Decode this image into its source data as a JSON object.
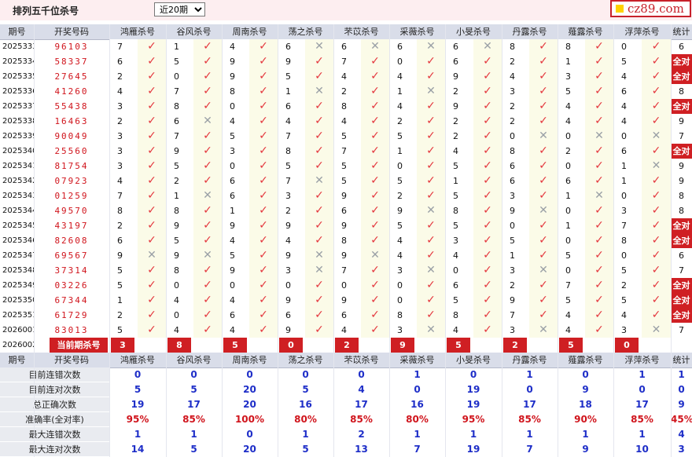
{
  "header": {
    "title": "排列五千位杀号",
    "range_selected": "近20期",
    "logo_text": "cz89.com"
  },
  "columns": [
    "期号",
    "开奖号码",
    "鸿雁杀号",
    "谷风杀号",
    "周南杀号",
    "荡之杀号",
    "芣苡杀号",
    "采薇杀号",
    "小旻杀号",
    "丹露杀号",
    "薤露杀号",
    "浮萍杀号",
    "统计"
  ],
  "rows": [
    {
      "period": "2025333",
      "draw": "96103",
      "kills": [
        7,
        1,
        4,
        6,
        6,
        6,
        6,
        8,
        8,
        0
      ],
      "marks": [
        1,
        1,
        1,
        0,
        0,
        0,
        0,
        1,
        1,
        1
      ],
      "stat": "6"
    },
    {
      "period": "2025334",
      "draw": "58337",
      "kills": [
        6,
        5,
        9,
        9,
        7,
        0,
        6,
        2,
        1,
        5
      ],
      "marks": [
        1,
        1,
        1,
        1,
        1,
        1,
        1,
        1,
        1,
        1
      ],
      "stat": "全对"
    },
    {
      "period": "2025335",
      "draw": "27645",
      "kills": [
        2,
        0,
        9,
        5,
        4,
        4,
        9,
        4,
        3,
        4
      ],
      "marks": [
        1,
        1,
        1,
        1,
        1,
        1,
        1,
        1,
        1,
        1
      ],
      "stat": "全对"
    },
    {
      "period": "2025336",
      "draw": "41260",
      "kills": [
        4,
        7,
        8,
        1,
        2,
        1,
        2,
        3,
        5,
        6
      ],
      "marks": [
        1,
        1,
        1,
        0,
        1,
        0,
        1,
        1,
        1,
        1
      ],
      "stat": "8"
    },
    {
      "period": "2025337",
      "draw": "55438",
      "kills": [
        3,
        8,
        0,
        6,
        8,
        4,
        9,
        2,
        4,
        4
      ],
      "marks": [
        1,
        1,
        1,
        1,
        1,
        1,
        1,
        1,
        1,
        1
      ],
      "stat": "全对"
    },
    {
      "period": "2025338",
      "draw": "16463",
      "kills": [
        2,
        6,
        4,
        4,
        4,
        2,
        2,
        2,
        4,
        4
      ],
      "marks": [
        1,
        0,
        1,
        1,
        1,
        1,
        1,
        1,
        1,
        1
      ],
      "stat": "9"
    },
    {
      "period": "2025339",
      "draw": "90049",
      "kills": [
        3,
        7,
        5,
        7,
        5,
        5,
        2,
        0,
        0,
        0
      ],
      "marks": [
        1,
        1,
        1,
        1,
        1,
        1,
        1,
        0,
        0,
        0
      ],
      "stat": "7"
    },
    {
      "period": "2025340",
      "draw": "25560",
      "kills": [
        3,
        9,
        3,
        8,
        7,
        1,
        4,
        8,
        2,
        6
      ],
      "marks": [
        1,
        1,
        1,
        1,
        1,
        1,
        1,
        1,
        1,
        1
      ],
      "stat": "全对"
    },
    {
      "period": "2025341",
      "draw": "81754",
      "kills": [
        3,
        5,
        0,
        5,
        5,
        0,
        5,
        6,
        0,
        1
      ],
      "marks": [
        1,
        1,
        1,
        1,
        1,
        1,
        1,
        1,
        1,
        0
      ],
      "stat": "9"
    },
    {
      "period": "2025342",
      "draw": "07923",
      "kills": [
        4,
        2,
        6,
        7,
        5,
        5,
        1,
        6,
        6,
        1
      ],
      "marks": [
        1,
        1,
        1,
        0,
        1,
        1,
        1,
        1,
        1,
        1
      ],
      "stat": "9"
    },
    {
      "period": "2025343",
      "draw": "01259",
      "kills": [
        7,
        1,
        6,
        3,
        9,
        2,
        5,
        3,
        1,
        0
      ],
      "marks": [
        1,
        0,
        1,
        1,
        1,
        1,
        1,
        1,
        0,
        1
      ],
      "stat": "8"
    },
    {
      "period": "2025344",
      "draw": "49570",
      "kills": [
        8,
        8,
        1,
        2,
        6,
        9,
        8,
        9,
        0,
        3
      ],
      "marks": [
        1,
        1,
        1,
        1,
        1,
        0,
        1,
        0,
        1,
        1
      ],
      "stat": "8"
    },
    {
      "period": "2025345",
      "draw": "43197",
      "kills": [
        2,
        9,
        9,
        9,
        9,
        5,
        5,
        0,
        1,
        7
      ],
      "marks": [
        1,
        1,
        1,
        1,
        1,
        1,
        1,
        1,
        1,
        1
      ],
      "stat": "全对"
    },
    {
      "period": "2025346",
      "draw": "82608",
      "kills": [
        6,
        5,
        4,
        4,
        8,
        4,
        3,
        5,
        0,
        8
      ],
      "marks": [
        1,
        1,
        1,
        1,
        1,
        1,
        1,
        1,
        1,
        1
      ],
      "stat": "全对"
    },
    {
      "period": "2025347",
      "draw": "69567",
      "kills": [
        9,
        9,
        5,
        9,
        9,
        4,
        4,
        1,
        5,
        0
      ],
      "marks": [
        0,
        0,
        1,
        0,
        0,
        1,
        1,
        1,
        1,
        1
      ],
      "stat": "6"
    },
    {
      "period": "2025348",
      "draw": "37314",
      "kills": [
        5,
        8,
        9,
        3,
        7,
        3,
        0,
        3,
        0,
        5
      ],
      "marks": [
        1,
        1,
        1,
        0,
        1,
        0,
        1,
        0,
        1,
        1
      ],
      "stat": "7"
    },
    {
      "period": "2025349",
      "draw": "03226",
      "kills": [
        5,
        0,
        0,
        0,
        0,
        0,
        6,
        2,
        7,
        2
      ],
      "marks": [
        1,
        1,
        1,
        1,
        1,
        1,
        1,
        1,
        1,
        1
      ],
      "stat": "全对"
    },
    {
      "period": "2025350",
      "draw": "67344",
      "kills": [
        1,
        4,
        4,
        9,
        9,
        0,
        5,
        9,
        5,
        5
      ],
      "marks": [
        1,
        1,
        1,
        1,
        1,
        1,
        1,
        1,
        1,
        1
      ],
      "stat": "全对"
    },
    {
      "period": "2025351",
      "draw": "61729",
      "kills": [
        2,
        0,
        6,
        6,
        6,
        8,
        8,
        7,
        4,
        4
      ],
      "marks": [
        1,
        1,
        1,
        1,
        1,
        1,
        1,
        1,
        1,
        1
      ],
      "stat": "全对"
    },
    {
      "period": "2026001",
      "draw": "83013",
      "kills": [
        5,
        4,
        4,
        9,
        4,
        3,
        4,
        3,
        4,
        3
      ],
      "marks": [
        1,
        1,
        1,
        1,
        1,
        0,
        1,
        0,
        1,
        0
      ],
      "stat": "7"
    }
  ],
  "current": {
    "period": "2026002",
    "label": "当前期杀号",
    "kills": [
      "3",
      "8",
      "5",
      "0",
      "2",
      "9",
      "5",
      "2",
      "5",
      "0"
    ]
  },
  "summary_header": [
    "期号",
    "开奖号码",
    "鸿雁杀号",
    "谷风杀号",
    "周南杀号",
    "荡之杀号",
    "芣苡杀号",
    "采薇杀号",
    "小旻杀号",
    "丹露杀号",
    "薤露杀号",
    "浮萍杀号",
    "统计"
  ],
  "summary": [
    {
      "label": "目前连错次数",
      "values": [
        "0",
        "0",
        "0",
        "0",
        "0",
        "1",
        "0",
        "1",
        "0",
        "1",
        "1"
      ]
    },
    {
      "label": "目前连对次数",
      "values": [
        "5",
        "5",
        "20",
        "5",
        "4",
        "0",
        "19",
        "0",
        "9",
        "0",
        "0"
      ]
    },
    {
      "label": "总正确次数",
      "values": [
        "19",
        "17",
        "20",
        "16",
        "17",
        "16",
        "19",
        "17",
        "18",
        "17",
        "9"
      ]
    },
    {
      "label": "准确率(全对率)",
      "values": [
        "95%",
        "85%",
        "100%",
        "80%",
        "85%",
        "80%",
        "95%",
        "85%",
        "90%",
        "85%",
        "45%"
      ],
      "accent": true
    },
    {
      "label": "最大连错次数",
      "values": [
        "1",
        "1",
        "0",
        "1",
        "2",
        "1",
        "1",
        "1",
        "1",
        "1",
        "4"
      ]
    },
    {
      "label": "最大连对次数",
      "values": [
        "14",
        "5",
        "20",
        "5",
        "13",
        "7",
        "19",
        "7",
        "9",
        "10",
        "3"
      ]
    }
  ],
  "colors": {
    "accent": "#cf1f23",
    "header_bg": "#d9dde9",
    "blue_value": "#1e2ec8"
  }
}
